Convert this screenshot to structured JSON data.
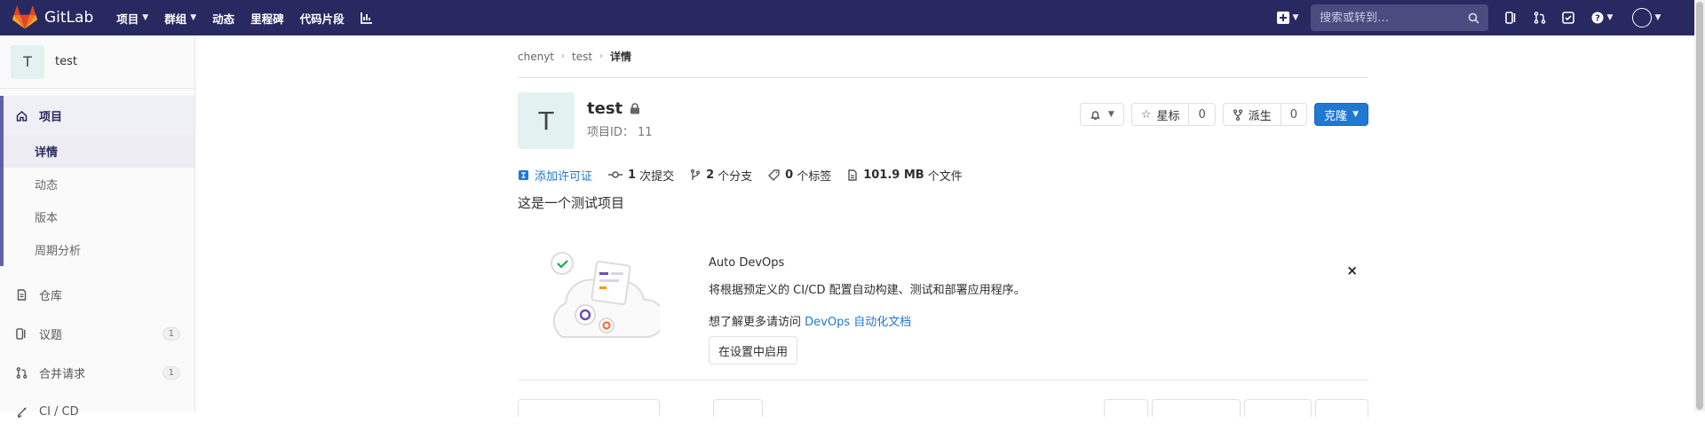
{
  "navbar": {
    "brand": "GitLab",
    "menu": [
      {
        "label": "项目",
        "caret": true
      },
      {
        "label": "群组",
        "caret": true
      },
      {
        "label": "动态",
        "caret": false
      },
      {
        "label": "里程碑",
        "caret": false
      },
      {
        "label": "代码片段",
        "caret": false
      }
    ],
    "search_placeholder": "搜索或转到…",
    "icons": [
      "chart-icon",
      "plus-icon",
      "issues-icon",
      "merge-request-icon",
      "todo-icon",
      "help-icon",
      "avatar"
    ],
    "bg_color": "#292961"
  },
  "sidebar": {
    "avatar_letter": "T",
    "project_name": "test",
    "section": {
      "label": "项目",
      "icon": "home-icon"
    },
    "sub_items": [
      {
        "label": "详情",
        "current": true
      },
      {
        "label": "动态",
        "current": false
      },
      {
        "label": "版本",
        "current": false
      },
      {
        "label": "周期分析",
        "current": false
      }
    ],
    "items": [
      {
        "label": "仓库",
        "icon": "repository-icon",
        "badge": ""
      },
      {
        "label": "议题",
        "icon": "issues-icon",
        "badge": "1"
      },
      {
        "label": "合并请求",
        "icon": "merge-request-icon",
        "badge": "1"
      },
      {
        "label": "CI / CD",
        "icon": "rocket-icon",
        "badge": ""
      }
    ]
  },
  "breadcrumb": {
    "items": [
      "chenyt",
      "test"
    ],
    "current": "详情"
  },
  "project": {
    "avatar_letter": "T",
    "name": "test",
    "id_label": "项目ID：",
    "id_value": "11",
    "star_label": "星标",
    "star_count": "0",
    "fork_label": "派生",
    "fork_count": "0",
    "clone_label": "克隆"
  },
  "stats": {
    "license": "添加许可证",
    "commits_num": "1",
    "commits_label": "次提交",
    "branches_num": "2",
    "branches_label": "个分支",
    "tags_num": "0",
    "tags_label": "个标签",
    "size_num": "101.9 MB",
    "size_label": "个文件"
  },
  "description": "这是一个测试项目",
  "devops": {
    "title": "Auto DevOps",
    "text": "将根据预定义的 CI/CD 配置自动构建、测试和部署应用程序。",
    "more_prefix": "想了解更多请访问 ",
    "more_link": "DevOps 自动化文档",
    "button": "在设置中启用",
    "close": "×"
  },
  "colors": {
    "accent": "#1f78d1",
    "sidebar_active": "#6060a8"
  }
}
